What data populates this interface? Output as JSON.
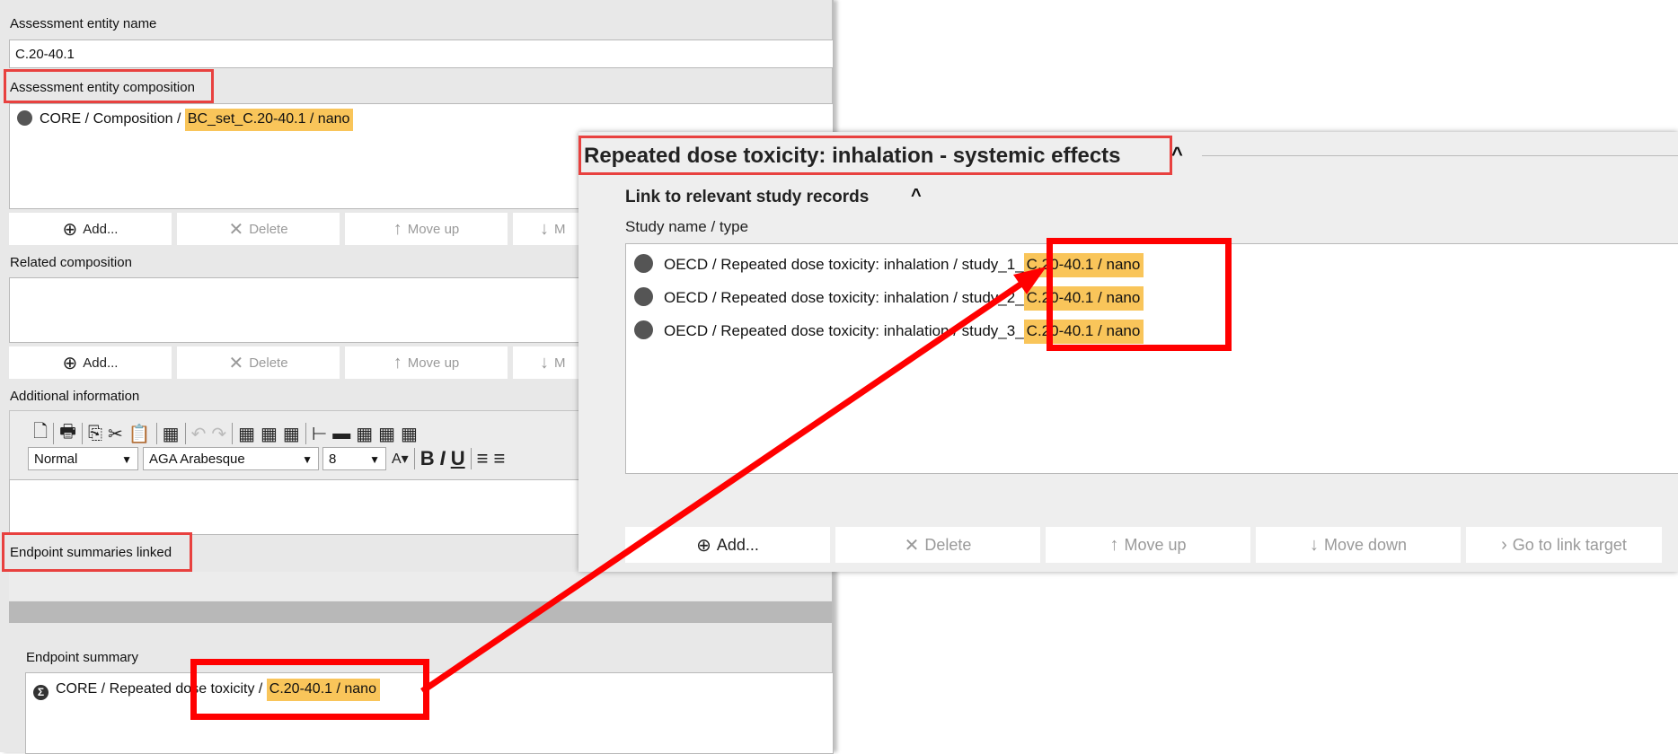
{
  "left_panel": {
    "entity_name_label": "Assessment entity name",
    "entity_name_value": "C.20-40.1",
    "composition_label": "Assessment entity composition",
    "composition_record_prefix": "CORE / Composition / ",
    "composition_record_highlight": "BC_set_C.20-40.1 / nano",
    "buttons": {
      "add": "Add...",
      "delete": "Delete",
      "move_up": "Move up",
      "move_down_partial": "M"
    },
    "related_composition_label": "Related composition",
    "additional_info_label": "Additional information",
    "toolbar": {
      "style_value": "Normal",
      "font_value": "AGA Arabesque",
      "size_value": "8",
      "bold": "B",
      "italic": "I",
      "underline": "U"
    },
    "endpoint_summaries_label": "Endpoint summaries linked",
    "endpoint_summary_label": "Endpoint summary",
    "endpoint_record_prefix": "CORE / Repeated dose toxicity / ",
    "endpoint_record_highlight": "C.20-40.1 / nano"
  },
  "right_panel": {
    "section_title": "Repeated dose toxicity: inhalation - systemic effects",
    "subsection_title": "Link to relevant study records",
    "column_label": "Study name / type",
    "records": [
      {
        "prefix": "OECD / Repeated dose toxicity: inhalation / study_1_",
        "highlight": "C.20-40.1 / nano"
      },
      {
        "prefix": "OECD / Repeated dose toxicity: inhalation / study_2_",
        "highlight": "C.20-40.1 / nano"
      },
      {
        "prefix": "OECD / Repeated dose toxicity: inhalation / study_3_",
        "highlight": "C.20-40.1 / nano"
      }
    ],
    "buttons": {
      "add": "Add...",
      "delete": "Delete",
      "move_up": "Move up",
      "move_down": "Move down",
      "go_to_link": "Go to link target"
    }
  },
  "colors": {
    "highlight": "#f9c55a",
    "annotation_red": "#ff0000",
    "panel_bg": "#e8e8e8"
  }
}
